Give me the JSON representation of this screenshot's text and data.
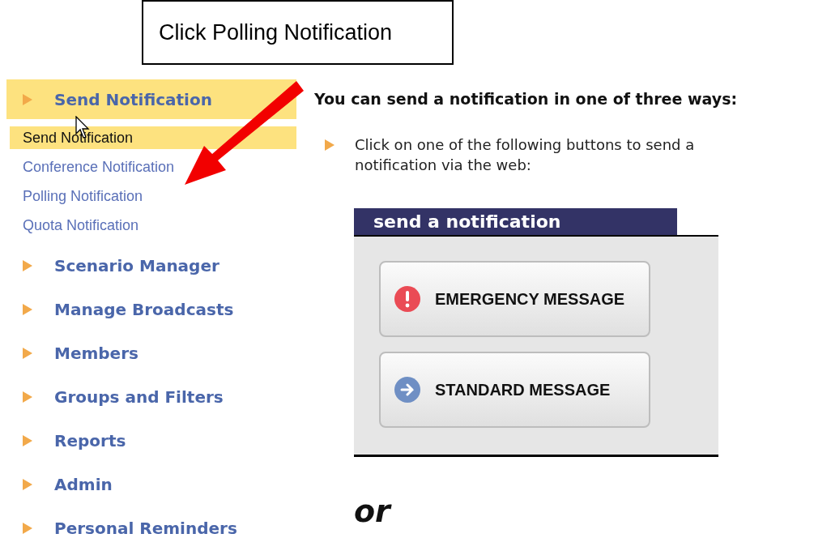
{
  "callout": {
    "text": "Click Polling Notification"
  },
  "sidebar": {
    "sections": [
      {
        "label": "Send Notification",
        "selected": true,
        "children": [
          {
            "label": "Send Notification",
            "selected": true
          },
          {
            "label": "Conference Notification",
            "selected": false
          },
          {
            "label": "Polling Notification",
            "selected": false
          },
          {
            "label": "Quota Notification",
            "selected": false
          }
        ]
      },
      {
        "label": "Scenario Manager",
        "selected": false
      },
      {
        "label": "Manage Broadcasts",
        "selected": false
      },
      {
        "label": "Members",
        "selected": false
      },
      {
        "label": "Groups and Filters",
        "selected": false
      },
      {
        "label": "Reports",
        "selected": false
      },
      {
        "label": "Admin",
        "selected": false
      },
      {
        "label": "Personal Reminders",
        "selected": false
      }
    ]
  },
  "main": {
    "heading": "You can send a notification in one of three ways:",
    "instruction": "Click on one of the following buttons to send a notification via the web:",
    "panel": {
      "title": "send a notification",
      "buttons": [
        {
          "label": "EMERGENCY MESSAGE",
          "kind": "emergency"
        },
        {
          "label": "STANDARD MESSAGE",
          "kind": "standard"
        }
      ]
    },
    "separator": "or"
  }
}
